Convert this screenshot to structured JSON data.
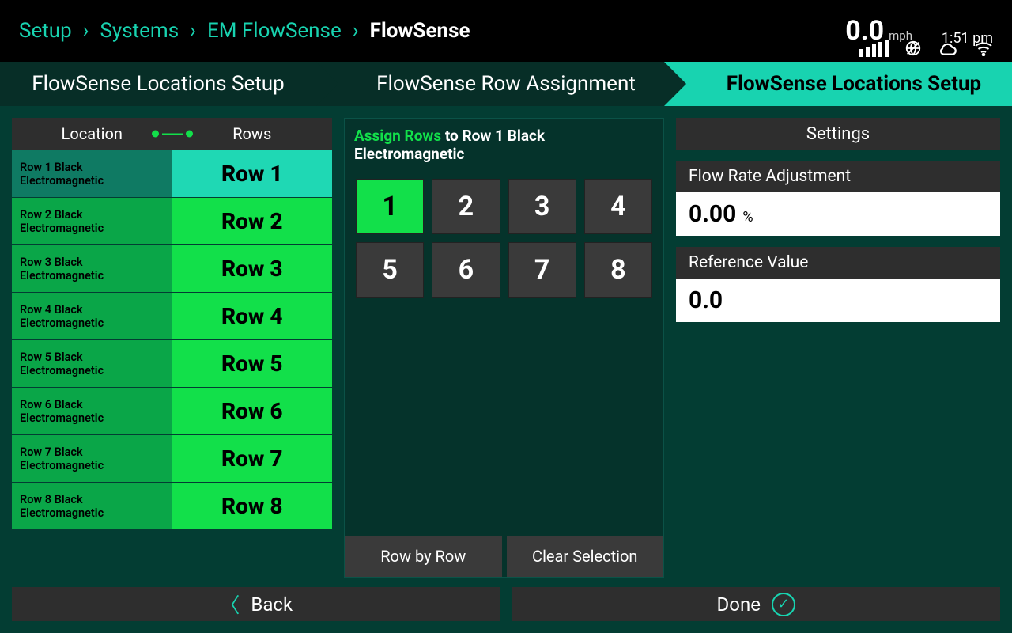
{
  "breadcrumb": {
    "items": [
      "Setup",
      "Systems",
      "EM FlowSense"
    ],
    "current": "FlowSense"
  },
  "status": {
    "speed_value": "0.0",
    "speed_unit": "mph",
    "clock": "1:51 pm"
  },
  "tabs": {
    "t0": "FlowSense Locations Setup",
    "t1": "FlowSense Row Assignment",
    "t2": "FlowSense Locations Setup"
  },
  "location_table": {
    "header_left": "Location",
    "header_right": "Rows",
    "rows": [
      {
        "loc": "Row 1 Black Electromagnetic",
        "row": "Row 1",
        "selected": true
      },
      {
        "loc": "Row 2 Black Electromagnetic",
        "row": "Row 2",
        "selected": false
      },
      {
        "loc": "Row 3 Black Electromagnetic",
        "row": "Row 3",
        "selected": false
      },
      {
        "loc": "Row 4 Black Electromagnetic",
        "row": "Row 4",
        "selected": false
      },
      {
        "loc": "Row 5 Black Electromagnetic",
        "row": "Row 5",
        "selected": false
      },
      {
        "loc": "Row 6 Black Electromagnetic",
        "row": "Row 6",
        "selected": false
      },
      {
        "loc": "Row 7 Black Electromagnetic",
        "row": "Row 7",
        "selected": false
      },
      {
        "loc": "Row 8 Black Electromagnetic",
        "row": "Row 8",
        "selected": false
      }
    ]
  },
  "assign": {
    "title_highlight": "Assign Rows",
    "title_rest": " to Row 1 Black Electromagnetic",
    "cells": [
      {
        "n": "1",
        "on": true
      },
      {
        "n": "2",
        "on": false
      },
      {
        "n": "3",
        "on": false
      },
      {
        "n": "4",
        "on": false
      },
      {
        "n": "5",
        "on": false
      },
      {
        "n": "6",
        "on": false
      },
      {
        "n": "7",
        "on": false
      },
      {
        "n": "8",
        "on": false
      }
    ],
    "row_by_row": "Row by Row",
    "clear": "Clear Selection"
  },
  "settings": {
    "title": "Settings",
    "flow_label": "Flow Rate Adjustment",
    "flow_value": "0.00",
    "flow_unit": "%",
    "ref_label": "Reference Value",
    "ref_value": "0.0"
  },
  "bottom": {
    "back": "Back",
    "done": "Done"
  }
}
